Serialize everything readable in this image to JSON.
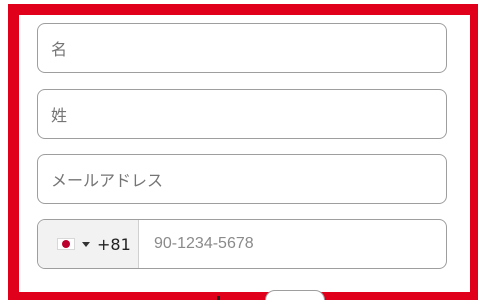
{
  "form": {
    "first_name_placeholder": "名",
    "last_name_placeholder": "姓",
    "email_placeholder": "メールアドレス",
    "phone": {
      "country_flag": "jp-flag-icon",
      "dial_code": "+81",
      "placeholder": "90-1234-5678"
    }
  },
  "highlight": {
    "color": "#e0001b"
  }
}
